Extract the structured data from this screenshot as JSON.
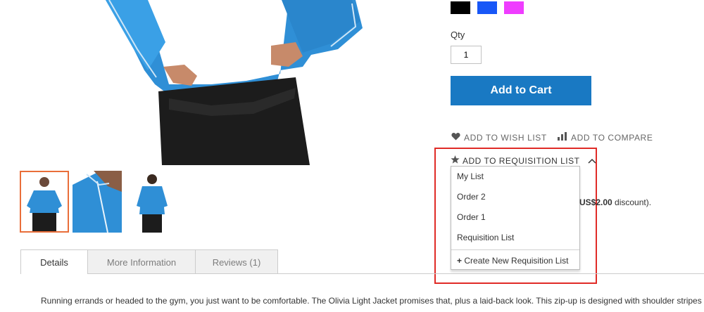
{
  "swatches": [
    {
      "name": "black",
      "color": "#000000"
    },
    {
      "name": "blue",
      "color": "#1857f7"
    },
    {
      "name": "pink",
      "color": "#ef3dff"
    }
  ],
  "qty": {
    "label": "Qty",
    "value": "1"
  },
  "add_to_cart_label": "Add to Cart",
  "actions": {
    "wishlist_label": "ADD TO WISH LIST",
    "compare_label": "ADD TO COMPARE",
    "requisition_label": "ADD TO REQUISITION LIST"
  },
  "requisition_dropdown": {
    "items": [
      "My List",
      "Order 2",
      "Order 1",
      "Requisition List"
    ],
    "create_label": "Create New Requisition List"
  },
  "discount_text": {
    "amount": "US$2.00",
    "suffix": " discount)."
  },
  "tabs": [
    "Details",
    "More Information",
    "Reviews (1)"
  ],
  "description": "Running errands or headed to the gym, you just want to be comfortable. The Olivia Light Jacket promises that, plus a laid-back look. This zip-up is designed with shoulder stripes",
  "colors": {
    "accent": "#1979c3",
    "highlight": "#e02b27",
    "thumb_active": "#e96e3a"
  }
}
